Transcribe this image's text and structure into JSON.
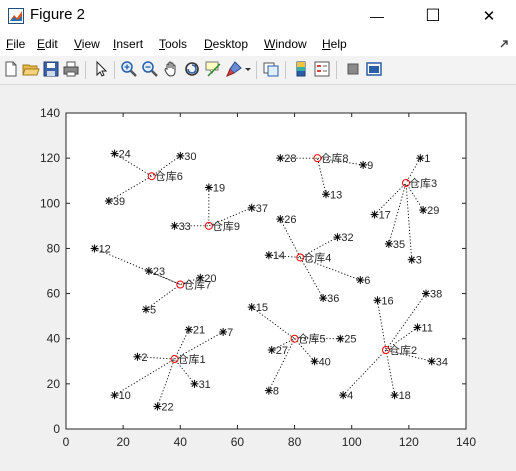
{
  "window": {
    "title": "Figure 2",
    "minimize_glyph": "—",
    "maximize_glyph": "☐",
    "close_glyph": "✕"
  },
  "menu": [
    {
      "key": "file",
      "mnemonic": "F",
      "rest": "ile"
    },
    {
      "key": "edit",
      "mnemonic": "E",
      "rest": "dit"
    },
    {
      "key": "view",
      "mnemonic": "V",
      "rest": "iew"
    },
    {
      "key": "insert",
      "mnemonic": "I",
      "rest": "nsert"
    },
    {
      "key": "tools",
      "mnemonic": "T",
      "rest": "ools"
    },
    {
      "key": "desktop",
      "mnemonic": "D",
      "rest": "esktop"
    },
    {
      "key": "window",
      "mnemonic": "W",
      "rest": "indow"
    },
    {
      "key": "help",
      "mnemonic": "H",
      "rest": "elp"
    }
  ],
  "toolbar": {
    "icons": [
      "new-figure-icon",
      "open-file-icon",
      "save-figure-icon",
      "print-figure-icon",
      "edit-plot-icon",
      "zoom-in-icon",
      "zoom-out-icon",
      "pan-icon",
      "rotate-3d-icon",
      "data-cursor-icon",
      "brush-icon",
      "brush-dropdown-icon",
      "link-plot-icon",
      "insert-colorbar-icon",
      "insert-legend-icon",
      "hide-plot-tools-icon",
      "show-plot-tools-icon"
    ]
  },
  "colors": {
    "customer_marker": "#000000",
    "warehouse_marker": "#ff0000",
    "link_line": "#000000",
    "axes_bg": "#ffffff",
    "figure_bg": "#f0f0f0"
  },
  "chart_data": {
    "type": "scatter",
    "title": "",
    "xlabel": "",
    "ylabel": "",
    "xlim": [
      0,
      140
    ],
    "ylim": [
      0,
      140
    ],
    "xticks": [
      0,
      20,
      40,
      60,
      80,
      100,
      120,
      140
    ],
    "yticks": [
      0,
      20,
      40,
      60,
      80,
      100,
      120,
      140
    ],
    "grid": false,
    "warehouses": [
      {
        "id": 1,
        "label": "仓库1",
        "x": 38,
        "y": 31
      },
      {
        "id": 2,
        "label": "仓库2",
        "x": 112,
        "y": 35
      },
      {
        "id": 3,
        "label": "仓库3",
        "x": 119,
        "y": 109
      },
      {
        "id": 4,
        "label": "仓库4",
        "x": 82,
        "y": 76
      },
      {
        "id": 5,
        "label": "仓库5",
        "x": 80,
        "y": 40
      },
      {
        "id": 6,
        "label": "仓库6",
        "x": 30,
        "y": 112
      },
      {
        "id": 7,
        "label": "仓库7",
        "x": 40,
        "y": 64
      },
      {
        "id": 8,
        "label": "仓库8",
        "x": 88,
        "y": 120
      },
      {
        "id": 9,
        "label": "仓库9",
        "x": 50,
        "y": 90
      }
    ],
    "customers": [
      {
        "id": "1",
        "x": 124,
        "y": 120,
        "warehouse": 3
      },
      {
        "id": "2",
        "x": 25,
        "y": 32,
        "warehouse": 1
      },
      {
        "id": "3",
        "x": 121,
        "y": 75,
        "warehouse": 3
      },
      {
        "id": "4",
        "x": 97,
        "y": 15,
        "warehouse": 2
      },
      {
        "id": "5",
        "x": 28,
        "y": 53,
        "warehouse": 7
      },
      {
        "id": "6",
        "x": 103,
        "y": 66,
        "warehouse": 4
      },
      {
        "id": "7",
        "x": 55,
        "y": 43,
        "warehouse": 1
      },
      {
        "id": "8",
        "x": 71,
        "y": 17,
        "warehouse": 5
      },
      {
        "id": "9",
        "x": 104,
        "y": 117,
        "warehouse": 8
      },
      {
        "id": "10",
        "x": 17,
        "y": 15,
        "warehouse": 1
      },
      {
        "id": "11",
        "x": 123,
        "y": 45,
        "warehouse": 2
      },
      {
        "id": "12",
        "x": 10,
        "y": 80,
        "warehouse": 7
      },
      {
        "id": "13",
        "x": 91,
        "y": 104,
        "warehouse": 8
      },
      {
        "id": "14",
        "x": 71,
        "y": 77,
        "warehouse": 4
      },
      {
        "id": "15",
        "x": 65,
        "y": 54,
        "warehouse": 5
      },
      {
        "id": "16",
        "x": 109,
        "y": 57,
        "warehouse": 2
      },
      {
        "id": "17",
        "x": 108,
        "y": 95,
        "warehouse": 3
      },
      {
        "id": "18",
        "x": 115,
        "y": 15,
        "warehouse": 2
      },
      {
        "id": "19",
        "x": 50,
        "y": 107,
        "warehouse": 9
      },
      {
        "id": "20",
        "x": 47,
        "y": 67,
        "warehouse": 7
      },
      {
        "id": "21",
        "x": 43,
        "y": 44,
        "warehouse": 1
      },
      {
        "id": "22",
        "x": 32,
        "y": 10,
        "warehouse": 1
      },
      {
        "id": "23",
        "x": 29,
        "y": 70,
        "warehouse": 7
      },
      {
        "id": "24",
        "x": 17,
        "y": 122,
        "warehouse": 6
      },
      {
        "id": "25",
        "x": 96,
        "y": 40,
        "warehouse": 5
      },
      {
        "id": "26",
        "x": 75,
        "y": 93,
        "warehouse": 4
      },
      {
        "id": "27",
        "x": 72,
        "y": 35,
        "warehouse": 5
      },
      {
        "id": "28",
        "x": 75,
        "y": 120,
        "warehouse": 8
      },
      {
        "id": "29",
        "x": 125,
        "y": 97,
        "warehouse": 3
      },
      {
        "id": "30",
        "x": 40,
        "y": 121,
        "warehouse": 6
      },
      {
        "id": "31",
        "x": 45,
        "y": 20,
        "warehouse": 1
      },
      {
        "id": "32",
        "x": 95,
        "y": 85,
        "warehouse": 4
      },
      {
        "id": "33",
        "x": 38,
        "y": 90,
        "warehouse": 9
      },
      {
        "id": "34",
        "x": 128,
        "y": 30,
        "warehouse": 2
      },
      {
        "id": "35",
        "x": 113,
        "y": 82,
        "warehouse": 3
      },
      {
        "id": "36",
        "x": 90,
        "y": 58,
        "warehouse": 4
      },
      {
        "id": "37",
        "x": 65,
        "y": 98,
        "warehouse": 9
      },
      {
        "id": "38",
        "x": 126,
        "y": 60,
        "warehouse": 2
      },
      {
        "id": "39",
        "x": 15,
        "y": 101,
        "warehouse": 6
      },
      {
        "id": "40",
        "x": 87,
        "y": 30,
        "warehouse": 5
      }
    ]
  }
}
